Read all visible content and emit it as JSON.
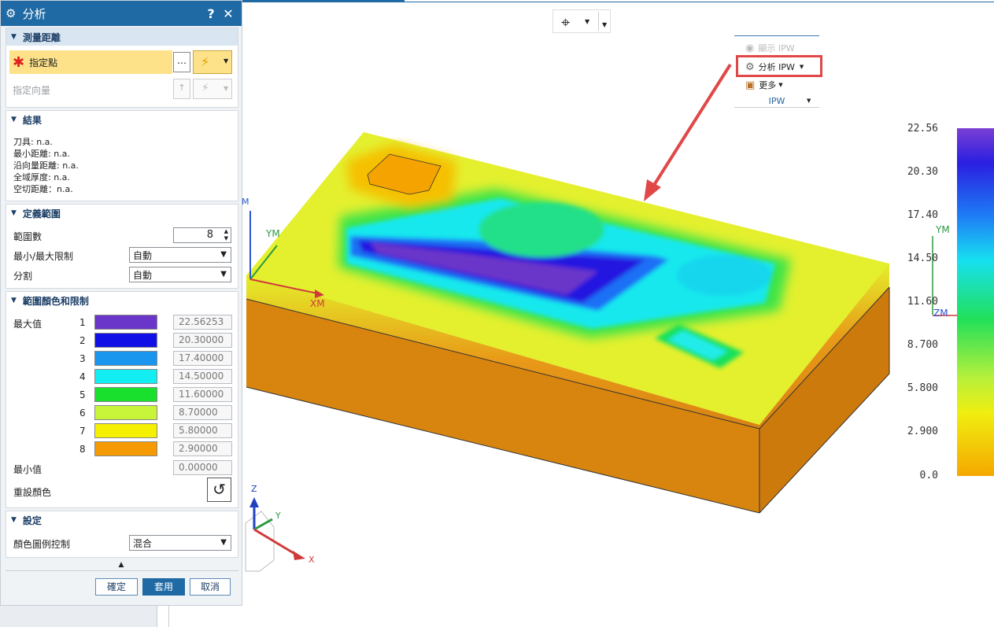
{
  "dialog": {
    "title": "分析",
    "help": "?",
    "close": "✕",
    "measure": {
      "header": "測量距離",
      "point_label": "指定點",
      "vector_label": "指定向量"
    },
    "results": {
      "header": "結果",
      "lines": [
        "刀具: n.a.",
        "最小距離: n.a.",
        "沿向量距離: n.a.",
        "全域厚度: n.a.",
        "空切距離：n.a."
      ]
    },
    "range": {
      "header": "定義範圍",
      "count_label": "範圍數",
      "count_value": "8",
      "minmax_label": "最小/最大限制",
      "minmax_value": "自動",
      "split_label": "分割",
      "split_value": "自動"
    },
    "colors": {
      "header": "範圍顏色和限制",
      "max_label": "最大值",
      "min_label": "最小值",
      "min_value": "0.00000",
      "reset_label": "重設顏色",
      "rows": [
        {
          "num": "1",
          "color": "#6a35c9",
          "value": "22.56253"
        },
        {
          "num": "2",
          "color": "#1010e6",
          "value": "20.30000"
        },
        {
          "num": "3",
          "color": "#1a96ef",
          "value": "17.40000"
        },
        {
          "num": "4",
          "color": "#12eef2",
          "value": "14.50000"
        },
        {
          "num": "5",
          "color": "#18e02c",
          "value": "11.60000"
        },
        {
          "num": "6",
          "color": "#c8f53a",
          "value": "8.70000"
        },
        {
          "num": "7",
          "color": "#f5f000",
          "value": "5.80000"
        },
        {
          "num": "8",
          "color": "#f59a00",
          "value": "2.90000"
        }
      ]
    },
    "settings": {
      "header": "設定",
      "legend_label": "顏色圖例控制",
      "legend_value": "混合"
    },
    "buttons": {
      "ok": "確定",
      "apply": "套用",
      "cancel": "取消"
    }
  },
  "ipw": {
    "show": "顯示 IPW",
    "analyze": "分析 IPW",
    "more": "更多",
    "group": "IPW"
  },
  "axes": {
    "ym": "YM",
    "xm": "XM",
    "m": "M",
    "zm": "ZM",
    "x": "X",
    "y": "Y",
    "z": "Z"
  },
  "legend": [
    "22.56",
    "20.30",
    "17.40",
    "14.50",
    "11.60",
    "8.700",
    "5.800",
    "2.900",
    "0.0"
  ]
}
